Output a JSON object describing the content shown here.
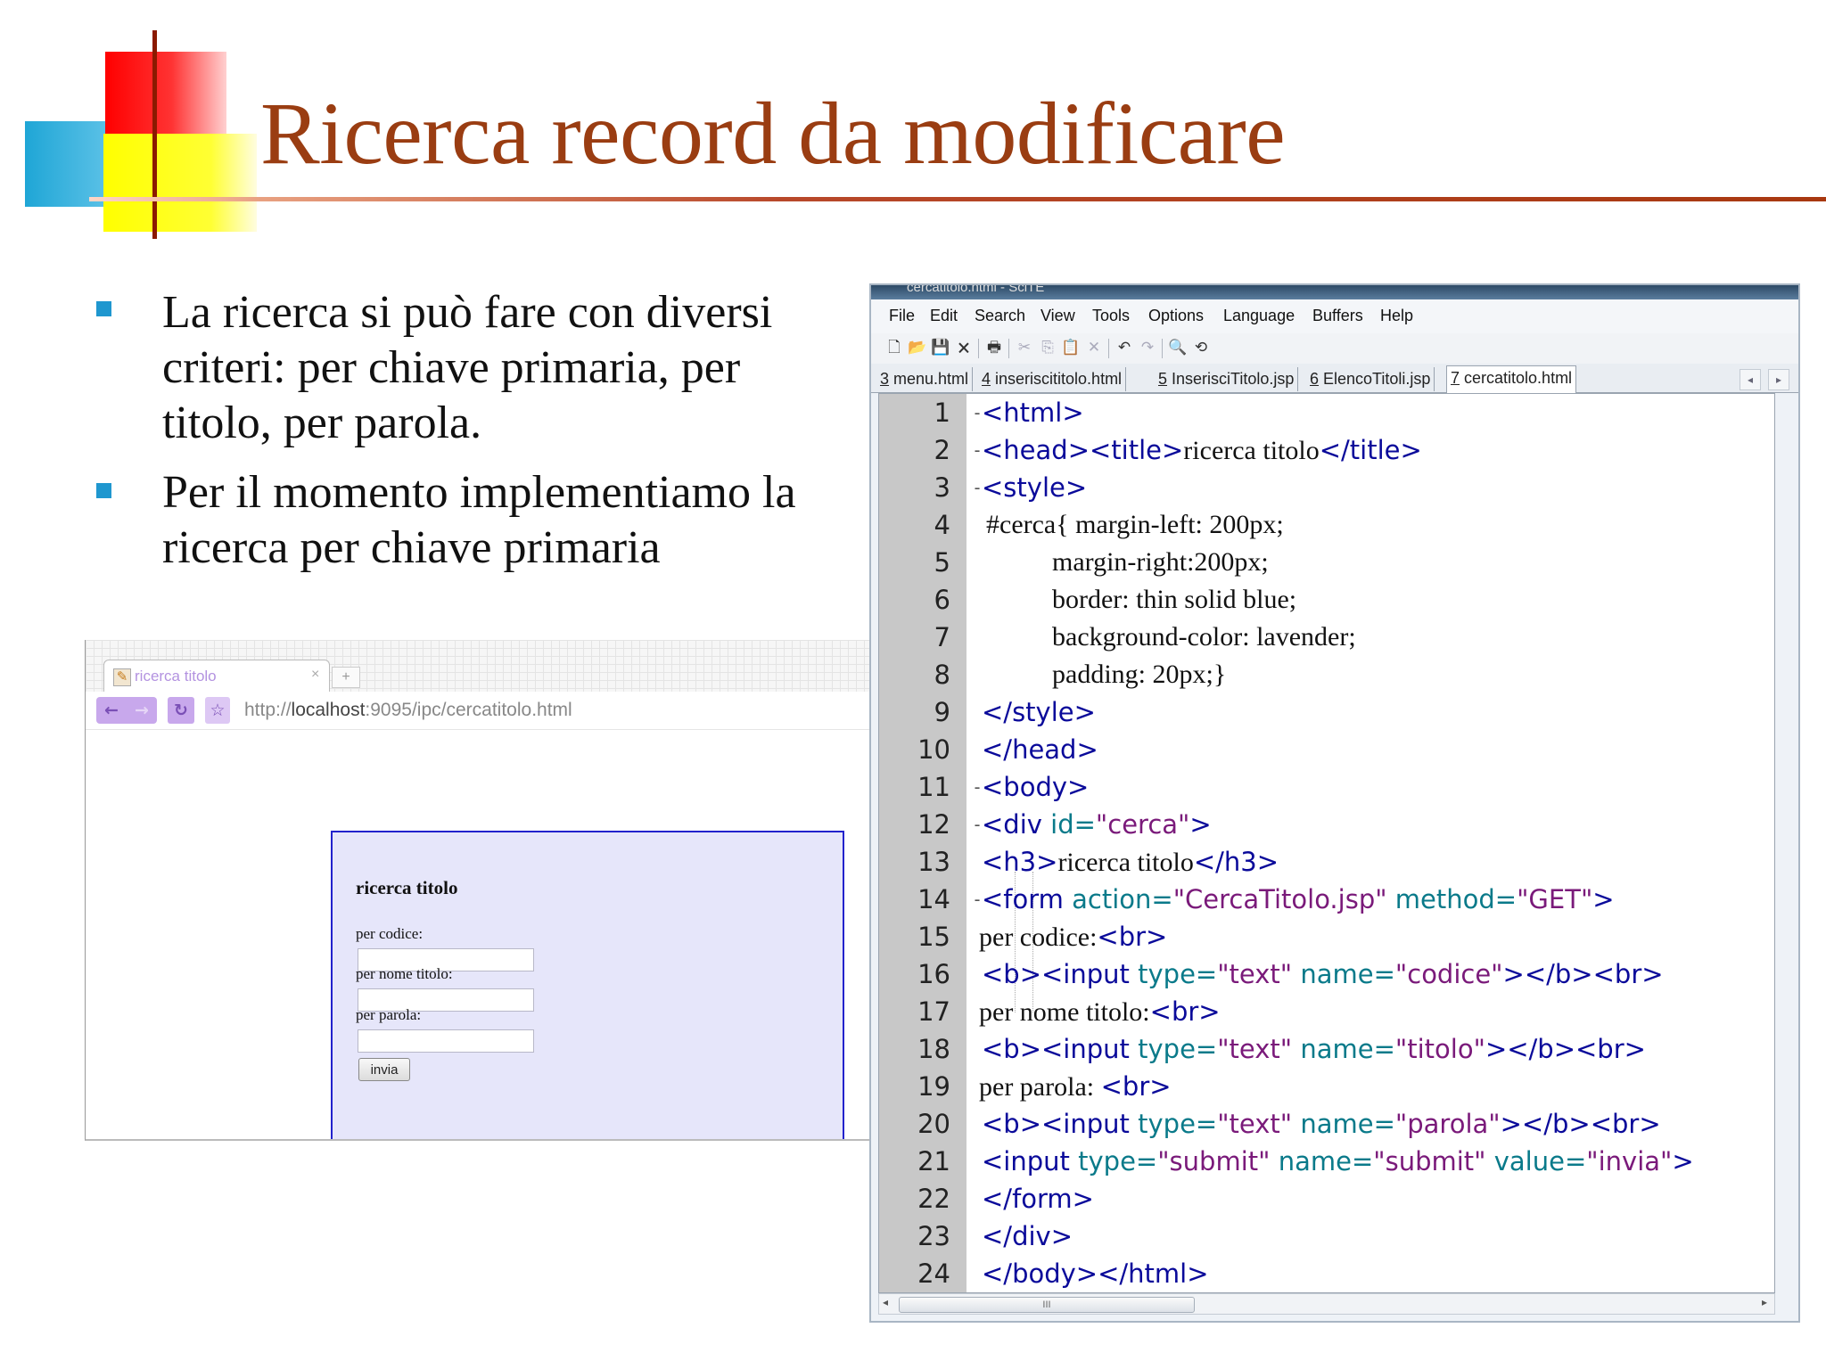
{
  "slide": {
    "title": "Ricerca record da modificare",
    "bullets": [
      "La ricerca si può fare con diversi criteri: per chiave primaria, per titolo, per parola.",
      "Per il momento implementiamo la ricerca per chiave primaria"
    ]
  },
  "browser": {
    "tab_title": "ricerca titolo",
    "tab_close": "×",
    "url_prefix": "http://",
    "url_host": "localhost",
    "url_rest": ":9095/ipc/cercatitolo.html",
    "page": {
      "heading": "ricerca titolo",
      "labels": [
        "per codice:",
        "per nome titolo:",
        "per parola:"
      ],
      "submit_label": "invia"
    }
  },
  "editor": {
    "window_title": "cercatitolo.html - SciTE",
    "menu": [
      "File",
      "Edit",
      "Search",
      "View",
      "Tools",
      "Options",
      "Language",
      "Buffers",
      "Help"
    ],
    "tabs": [
      {
        "num": "3",
        "name": " menu.html"
      },
      {
        "num": "4",
        "name": " inseriscititolo.html"
      },
      {
        "num": "5",
        "name": " InserisciTitolo.jsp"
      },
      {
        "num": "6",
        "name": " ElencoTitoli.jsp"
      },
      {
        "num": "7",
        "name": " cercatitolo.html"
      }
    ],
    "line_numbers": [
      "1",
      "2",
      "3",
      "4",
      "5",
      "6",
      "7",
      "8",
      "9",
      "10",
      "11",
      "12",
      "13",
      "14",
      "15",
      "16",
      "17",
      "18",
      "19",
      "20",
      "21",
      "22",
      "23",
      "24"
    ],
    "code": {
      "l1_tag": "<html>",
      "l2_tag_a": "<head><title>",
      "l2_text": "ricerca titolo",
      "l2_tag_b": "</title>",
      "l3_tag": "<style>",
      "l4": "#cerca{ margin-left: 200px;",
      "l5": "margin-right:200px;",
      "l6": "border: thin solid blue;",
      "l7": "background-color: lavender;",
      "l8": "padding: 20px;}",
      "l9_tag": "</style>",
      "l10_tag": "</head>",
      "l11_tag": "<body>",
      "l12_tag_a": "<div",
      "l12_attr": " id=",
      "l12_str": "\"cerca\"",
      "l12_tag_b": ">",
      "l13_tag_a": "<h3>",
      "l13_text": "ricerca titolo",
      "l13_tag_b": "</h3>",
      "l14_tag_a": "<form",
      "l14_attr_a": " action=",
      "l14_str_a": "\"CercaTitolo.jsp\"",
      "l14_attr_b": " method=",
      "l14_str_b": "\"GET\"",
      "l14_tag_b": ">",
      "l15_text": "per codice:",
      "l15_tag": "<br>",
      "l16_tag_a": "<b><input",
      "l16_attr_a": " type=",
      "l16_str_a": "\"text\"",
      "l16_attr_b": " name=",
      "l16_str_b": "\"codice\"",
      "l16_tag_b": "></b><br>",
      "l17_text": "per nome titolo:",
      "l17_tag": "<br>",
      "l18_tag_a": "<b><input",
      "l18_attr_a": " type=",
      "l18_str_a": "\"text\"",
      "l18_attr_b": " name=",
      "l18_str_b": "\"titolo\"",
      "l18_tag_b": "></b><br>",
      "l19_text": "per parola: ",
      "l19_tag": "<br>",
      "l20_tag_a": "<b><input",
      "l20_attr_a": " type=",
      "l20_str_a": "\"text\"",
      "l20_attr_b": " name=",
      "l20_str_b": "\"parola\"",
      "l20_tag_b": "></b><br>",
      "l21_tag_a": "<input",
      "l21_attr_a": " type=",
      "l21_str_a": "\"submit\"",
      "l21_attr_b": " name=",
      "l21_str_b": "\"submit\"",
      "l21_attr_c": " value=",
      "l21_str_c": "\"invia\"",
      "l21_tag_b": ">",
      "l22_tag": "</form>",
      "l23_tag": "</div>",
      "l24_tag": "</body></html>"
    },
    "scroll_grip": "III"
  },
  "colors": {
    "title": "#9a3d12",
    "bullet": "#1f97cf",
    "tag": "#0a0a9a",
    "attribute": "#0a7a8a",
    "string": "#7a1a7a",
    "form_box_bg": "#e6e6fa",
    "form_box_border": "#2222cc"
  }
}
